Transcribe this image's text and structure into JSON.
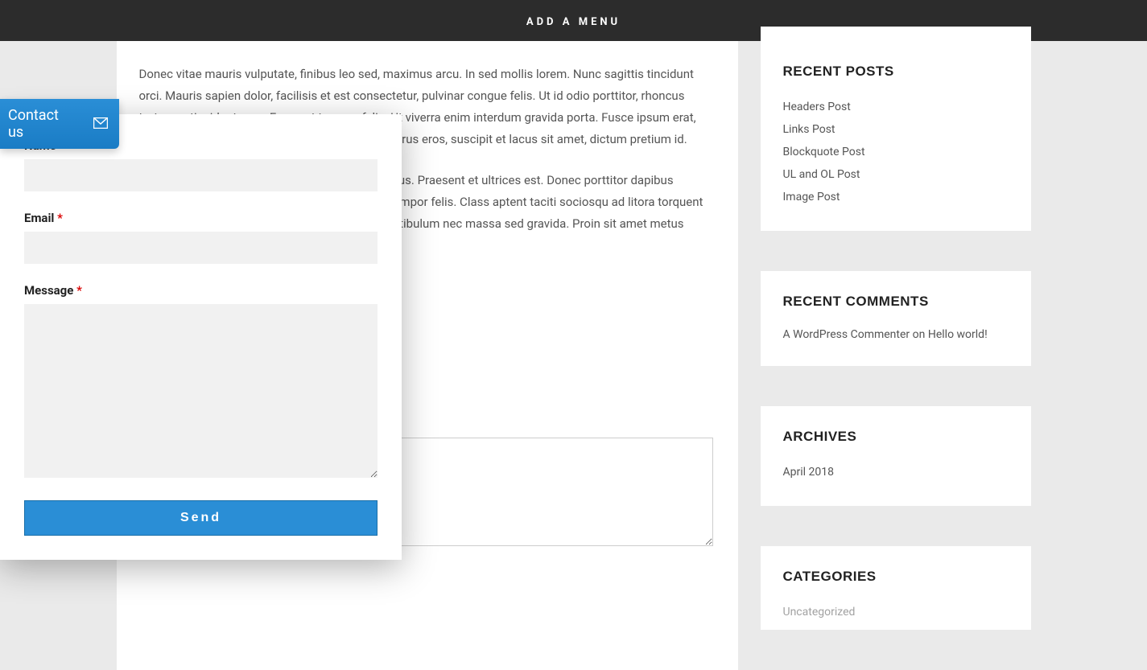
{
  "nav": {
    "label": "ADD A MENU"
  },
  "main": {
    "paragraph1": "Donec vitae mauris vulputate, finibus leo sed, maximus arcu. In sed mollis lorem. Nunc sagittis tincidunt orci. Mauris sapien dolor, facilisis et est consectetur, pulvinar congue felis. Ut id odio porttitor, rhoncus tortor ac, tincidunt eros. Fusce at tempus felis. Ut viverra enim interdum gravida porta. Fusce ipsum erat, varius sed bibendum id, aliquam sed velit. Sed purus eros, suscipit et lacus sit amet, dictum pretium id.",
    "paragraph2": "Nunc at interdum ante. Vestibulum ut mattis lectus. Praesent et ultrices est. Donec porttitor dapibus ultrices. Sed fermentum id velit non commodo tempor felis. Class aptent taciti sociosqu ad litora torquent per conubia nostra, per inceptos himenaeos. Vestibulum nec massa sed gravida. Proin sit amet metus lectus."
  },
  "sidebar": {
    "recent_posts": {
      "title": "RECENT POSTS",
      "items": [
        "Headers Post",
        "Links Post",
        "Blockquote Post",
        "UL and OL Post",
        "Image Post"
      ]
    },
    "recent_comments": {
      "title": "RECENT COMMENTS",
      "commenter": "A WordPress Commenter",
      "sep": " on ",
      "target": "Hello world!"
    },
    "archives": {
      "title": "ARCHIVES",
      "items": [
        "April 2018"
      ]
    },
    "categories": {
      "title": "CATEGORIES",
      "items": [
        "Uncategorized"
      ]
    }
  },
  "contact": {
    "tab_label": "Contact us",
    "name_label": "Name",
    "email_label": "Email",
    "message_label": "Message",
    "required_mark": "*",
    "send_label": "Send"
  }
}
